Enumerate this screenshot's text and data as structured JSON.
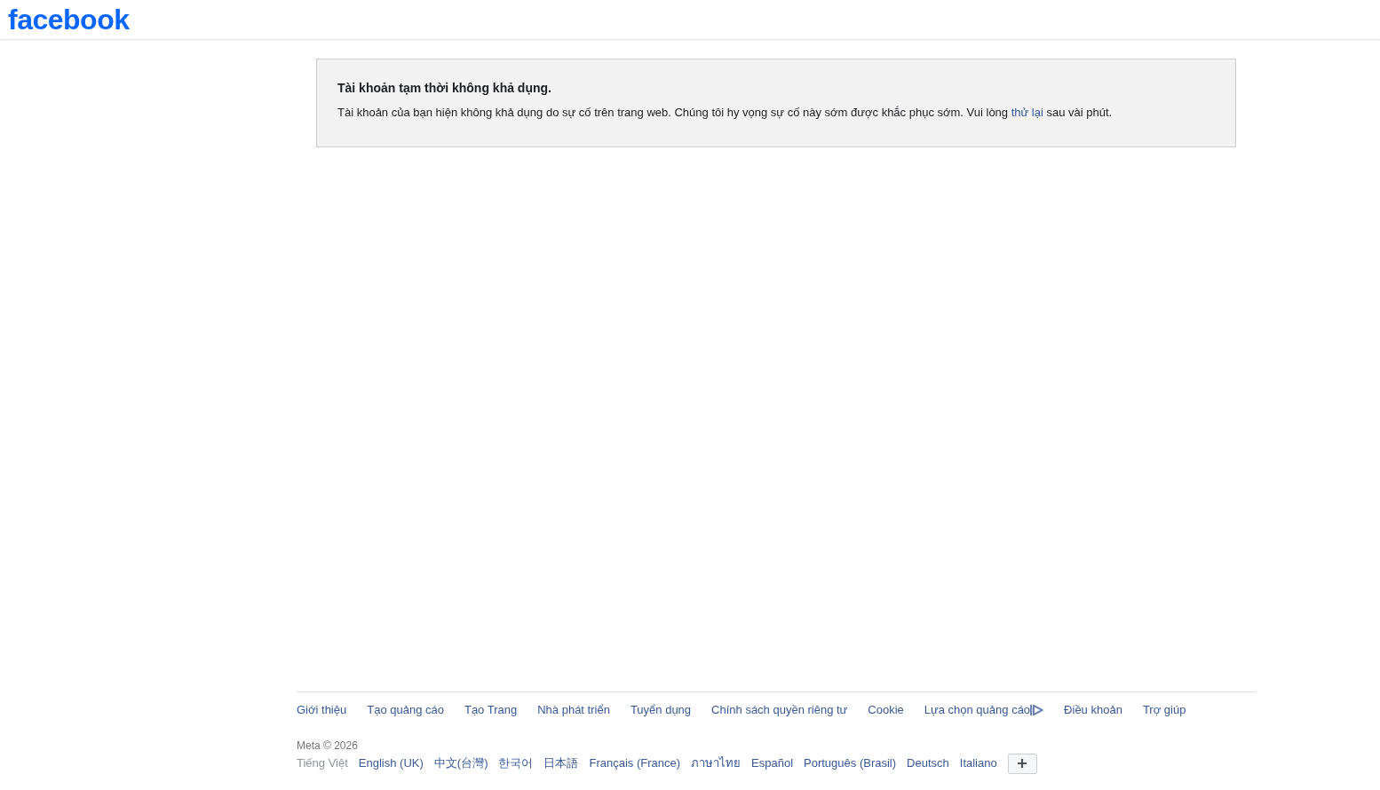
{
  "header": {
    "logo": "facebook"
  },
  "notice": {
    "title": "Tài khoản tạm thời không khả dụng.",
    "message": {
      "before": "Tài khoản của bạn hiện không khả dụng do sự cố trên trang web. Chúng tôi hy vọng sự cố này sớm được khắc phục sớm. Vui lòng",
      "link": "thử lại",
      "after": "sau vài phút."
    }
  },
  "footer": {
    "links": [
      {
        "label": "Giới thiệu",
        "kind": "text"
      },
      {
        "label": "Tạo quảng cáo",
        "kind": "text"
      },
      {
        "label": "Tạo Trang",
        "kind": "text"
      },
      {
        "label": "Nhà phát triển",
        "kind": "text"
      },
      {
        "label": "Tuyển dụng",
        "kind": "text"
      },
      {
        "label": "Chính sách quyền riêng tư",
        "kind": "text"
      },
      {
        "label": "Cookie",
        "kind": "text"
      },
      {
        "label": "Lựa chọn quảng cáo",
        "kind": "ad_choices"
      },
      {
        "label": "Điều khoản",
        "kind": "text"
      },
      {
        "label": "Trợ giúp",
        "kind": "text"
      }
    ],
    "copyright": "Meta © 2026",
    "languages": [
      {
        "label": "Tiếng Việt",
        "selected": true
      },
      {
        "label": "English (UK)",
        "selected": false
      },
      {
        "label": "中文(台灣)",
        "selected": false
      },
      {
        "label": "한국어",
        "selected": false
      },
      {
        "label": "日本語",
        "selected": false
      },
      {
        "label": "Français (France)",
        "selected": false
      },
      {
        "label": "ภาษาไทย",
        "selected": false
      },
      {
        "label": "Español",
        "selected": false
      },
      {
        "label": "Português (Brasil)",
        "selected": false
      },
      {
        "label": "Deutsch",
        "selected": false
      },
      {
        "label": "Italiano",
        "selected": false
      }
    ]
  }
}
